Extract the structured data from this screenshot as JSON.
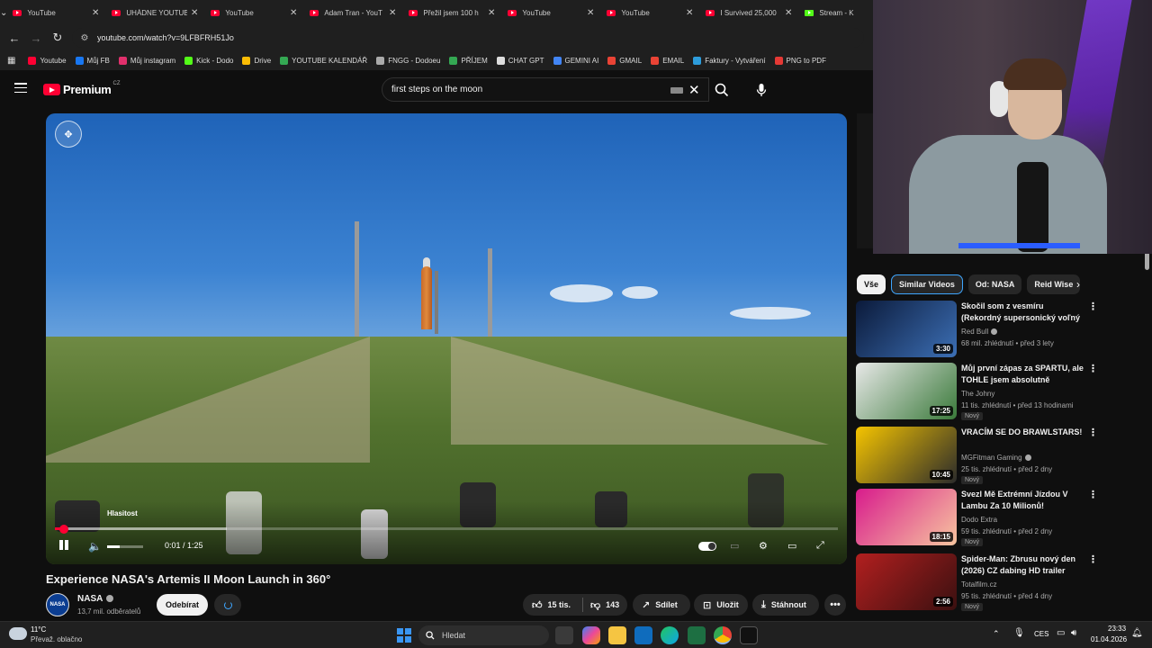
{
  "browser": {
    "tabs": [
      {
        "title": "YouTube",
        "icon": "youtube"
      },
      {
        "title": "UHÁDNE YOUTUB",
        "icon": "youtube"
      },
      {
        "title": "YouTube",
        "icon": "youtube"
      },
      {
        "title": "Adam Tran - YouT",
        "icon": "youtube"
      },
      {
        "title": "Přežil jsem 100 h",
        "icon": "youtube"
      },
      {
        "title": "YouTube",
        "icon": "youtube"
      },
      {
        "title": "YouTube",
        "icon": "youtube"
      },
      {
        "title": "I Survived 25,000",
        "icon": "youtube"
      },
      {
        "title": "Stream - K",
        "icon": "kick"
      }
    ],
    "url": "youtube.com/watch?v=9LFBFRH51Jo",
    "bookmarks": [
      {
        "label": "Youtube",
        "color": "#ff0033"
      },
      {
        "label": "Můj FB",
        "color": "#1877f2"
      },
      {
        "label": "Můj instagram",
        "color": "#e1306c"
      },
      {
        "label": "Kick - Dodo",
        "color": "#53fc18"
      },
      {
        "label": "Drive",
        "color": "#fbbc04"
      },
      {
        "label": "YOUTUBE KALENDÁŘ",
        "color": "#34a853"
      },
      {
        "label": "FNGG - Dodoeu",
        "color": "#aaaaaa"
      },
      {
        "label": "PŘÍJEM",
        "color": "#34a853"
      },
      {
        "label": "CHAT GPT",
        "color": "#dddddd"
      },
      {
        "label": "GEMINI AI",
        "color": "#4285f4"
      },
      {
        "label": "GMAIL",
        "color": "#ea4335"
      },
      {
        "label": "EMAIL",
        "color": "#ea4335"
      },
      {
        "label": "Faktury - Vytváření",
        "color": "#2d9cdb"
      },
      {
        "label": "PNG to PDF",
        "color": "#e53935"
      }
    ]
  },
  "header": {
    "logo_text": "Premium",
    "logo_region": "CZ",
    "search_value": "first steps on the moon"
  },
  "player": {
    "volume_tooltip": "Hlasitost",
    "time": "0:01 / 1:25",
    "progress_played_fraction": 0.012,
    "progress_buffered_fraction": 0.22,
    "volume_level_fraction": 0.35
  },
  "video": {
    "title": "Experience NASA's Artemis II Moon Launch in 360°",
    "channel": "NASA",
    "channel_avatar_text": "NASA",
    "subscribers": "13,7 mil. odběratelů",
    "subscribe_label": "Odebírat",
    "likes": "15 tis.",
    "dislikes": "143",
    "share_label": "Sdílet",
    "save_label": "Uložit",
    "download_label": "Stáhnout"
  },
  "sidebar": {
    "chips": [
      "Vše",
      "Similar Videos",
      "Od: NASA",
      "Reid Wise"
    ],
    "recommendations": [
      {
        "title": "Skočil som z vesmíru (Rekordný supersonický voľný pád)",
        "channel": "Red Bull",
        "verified": true,
        "meta": "68 mil. zhlédnutí • před 3 lety",
        "duration": "3:30",
        "is_new": false,
        "colors": [
          "#0b1a3a",
          "#3c6fb5"
        ]
      },
      {
        "title": "Můj první zápas za SPARTU, ale TOHLE jsem absolutně nečeka...",
        "channel": "The Johny",
        "verified": false,
        "meta": "11 tis. zhlédnutí • před 13 hodinami",
        "duration": "17:25",
        "is_new": true,
        "new_label": "Nový",
        "colors": [
          "#e8e8e8",
          "#3a7a3a"
        ]
      },
      {
        "title": "VRACÍM SE DO BRAWLSTARS!",
        "channel": "MGFitman Gaming",
        "verified": true,
        "meta": "25 tis. zhlédnutí • před 2 dny",
        "duration": "10:45",
        "is_new": true,
        "new_label": "Nový",
        "colors": [
          "#f5c400",
          "#2b2b2b"
        ]
      },
      {
        "title": "Svezl Mě Extrémní Jízdou V Lambu Za 10 Milionů!",
        "channel": "Dodo Extra",
        "verified": false,
        "meta": "59 tis. zhlédnutí • před 2 dny",
        "duration": "18:15",
        "is_new": true,
        "new_label": "Nový",
        "colors": [
          "#d81b8c",
          "#f7c59f"
        ]
      },
      {
        "title": "Spider-Man: Zbrusu nový den (2026) CZ dabing HD trailer",
        "channel": "Totalfilm.cz",
        "verified": false,
        "meta": "95 tis. zhlédnutí • před 4 dny",
        "duration": "2:56",
        "is_new": true,
        "new_label": "Nový",
        "colors": [
          "#b21f1f",
          "#3a1010"
        ]
      }
    ]
  },
  "taskbar": {
    "weather_temp": "11°C",
    "weather_desc": "Převaž. oblačno",
    "search_placeholder": "Hledat",
    "language": "CES",
    "time": "23:33",
    "date": "01.04.2026"
  }
}
